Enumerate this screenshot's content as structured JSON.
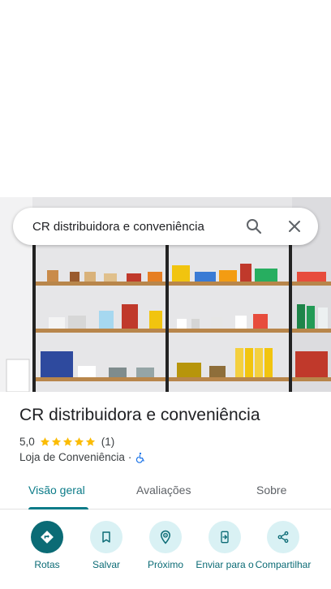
{
  "search": {
    "query": "CR distribuidora e conveniência"
  },
  "place": {
    "name": "CR distribuidora e conveniência",
    "rating": "5,0",
    "stars": 5,
    "review_count": "(1)",
    "category": "Loja de Conveniência",
    "separator": "·"
  },
  "tabs": [
    {
      "label": "Visão geral",
      "active": true
    },
    {
      "label": "Avaliações",
      "active": false
    },
    {
      "label": "Sobre",
      "active": false
    }
  ],
  "actions": [
    {
      "label": "Rotas",
      "icon": "directions-icon"
    },
    {
      "label": "Salvar",
      "icon": "bookmark-icon"
    },
    {
      "label": "Próximo",
      "icon": "nearby-icon"
    },
    {
      "label": "Enviar para o",
      "icon": "send-to-phone-icon"
    },
    {
      "label": "Compartilhar",
      "icon": "share-icon"
    }
  ],
  "colors": {
    "accent": "#0b7b88",
    "action_bg": "#d9f1f4",
    "primary_action": "#0b6b75",
    "star": "#fbbc04"
  }
}
